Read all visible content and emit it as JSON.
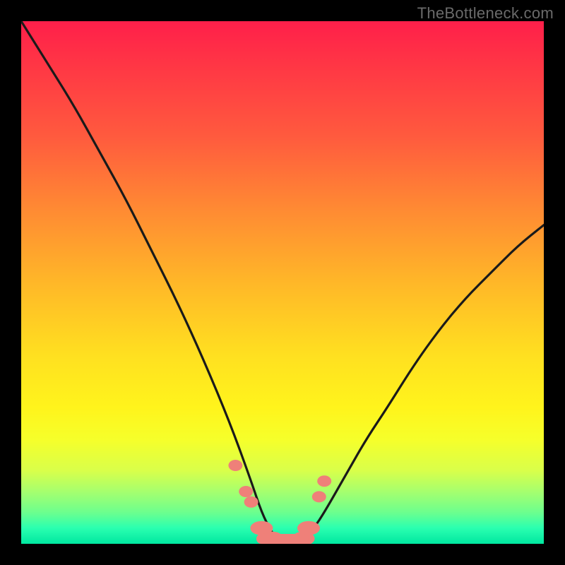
{
  "watermark": "TheBottleneck.com",
  "chart_data": {
    "type": "line",
    "title": "",
    "xlabel": "",
    "ylabel": "",
    "xlim": [
      0,
      100
    ],
    "ylim": [
      0,
      100
    ],
    "grid": false,
    "legend": false,
    "note": "Axes are unlabeled percentage scales. The curve resembles a bottleneck / compatibility profile: y≈100 (worst, red) at the left, dipping to y≈0 (best, green) near x≈50, then rising toward y≈60 at the right edge.",
    "x": [
      0,
      5,
      10,
      15,
      20,
      25,
      30,
      35,
      40,
      44,
      46,
      48,
      50,
      52,
      54,
      56,
      58,
      62,
      66,
      70,
      75,
      80,
      85,
      90,
      95,
      100
    ],
    "y": [
      100,
      92,
      84,
      75,
      66,
      56,
      46,
      35,
      23,
      12,
      6,
      2,
      0,
      0,
      1,
      3,
      6,
      13,
      20,
      26,
      34,
      41,
      47,
      52,
      57,
      61
    ],
    "markers": {
      "x": [
        41,
        43,
        44,
        46,
        48,
        50,
        52,
        54,
        55,
        57,
        58
      ],
      "y": [
        15,
        10,
        8,
        3,
        1,
        0,
        0,
        1,
        3,
        9,
        12
      ]
    }
  },
  "colors": {
    "curve": "#1a1a1a",
    "marker": "#ef8079",
    "frame": "#000000"
  }
}
